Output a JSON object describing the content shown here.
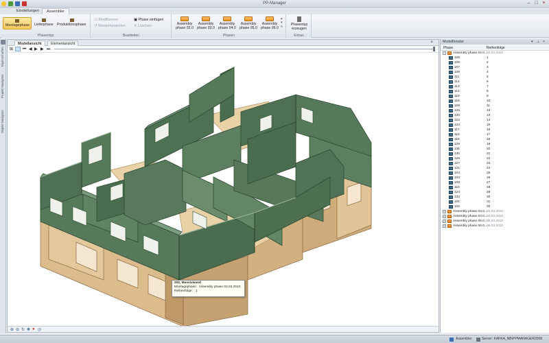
{
  "app": {
    "title": "PP-Manager"
  },
  "ribbon_tabs": [
    {
      "label": "Einstellungen"
    },
    {
      "label": "Assembler"
    }
  ],
  "ribbon": {
    "phasentyp": {
      "label": "Phasentyp",
      "buttons": [
        "Montagephase",
        "Lieferphase",
        "Produktionsphase"
      ]
    },
    "bearbeiten": {
      "label": "Bearbeiten",
      "buttons": [
        "Modifizieren",
        "Wiederherstellen",
        "Phase einfügen",
        "Löschen"
      ]
    },
    "phasen": {
      "label": "Phasen",
      "buttons": [
        {
          "line1": "Assembly",
          "line2": "phase 02.0"
        },
        {
          "line1": "Assembly",
          "line2": "phase 03.0"
        },
        {
          "line1": "Assembly",
          "line2": "phase 04.0"
        },
        {
          "line1": "Assembly",
          "line2": "phase 05.0"
        },
        {
          "line1": "Assembly",
          "line2": "phase 06.0"
        }
      ]
    },
    "extras": {
      "label": "Extras",
      "button_line1": "Phasentyp",
      "button_line2": "erzeugen"
    }
  },
  "left_strip": [
    "Eigenschaften",
    "Projekt Navigator",
    "Objekt Navigator"
  ],
  "doc_tabs": [
    {
      "label": "Modellansicht"
    },
    {
      "label": "Elementansicht"
    }
  ],
  "tooltip": {
    "title": "202, Massivwand",
    "line1_label": "Montagephase:",
    "line1_value": "Assembly phase 03.03.2010",
    "line2_label": "Reihenfolge:",
    "line2_value": "1"
  },
  "panel": {
    "title": "Modellfenster",
    "col_phase": "Phase",
    "col_order": "Reihenfolge",
    "phases": [
      {
        "name": "Assembly phase 02.0...",
        "date": "02.03.2010"
      },
      {
        "name": "Assembly phase 03.0...",
        "date": "03.03.2010"
      },
      {
        "name": "Assembly phase 04.0...",
        "date": "04.03.2010"
      },
      {
        "name": "Assembly phase 05.0...",
        "date": "05.03.2010"
      },
      {
        "name": "Assembly phase 06.0...",
        "date": "06.03.2010"
      }
    ],
    "elements": [
      {
        "name": "105",
        "order": "1"
      },
      {
        "name": "106",
        "order": "2"
      },
      {
        "name": "107",
        "order": "3"
      },
      {
        "name": "108",
        "order": "4"
      },
      {
        "name": "111",
        "order": "5"
      },
      {
        "name": "112",
        "order": "6"
      },
      {
        "name": "113",
        "order": "7"
      },
      {
        "name": "114",
        "order": "8"
      },
      {
        "name": "119",
        "order": "9"
      },
      {
        "name": "118",
        "order": "10"
      },
      {
        "name": "128",
        "order": "11"
      },
      {
        "name": "125",
        "order": "12"
      },
      {
        "name": "120",
        "order": "13"
      },
      {
        "name": "122",
        "order": "14"
      },
      {
        "name": "123",
        "order": "15"
      },
      {
        "name": "117",
        "order": "16"
      },
      {
        "name": "115",
        "order": "17"
      },
      {
        "name": "116",
        "order": "18"
      },
      {
        "name": "129",
        "order": "19"
      },
      {
        "name": "131",
        "order": "20"
      },
      {
        "name": "130",
        "order": "21"
      },
      {
        "name": "126",
        "order": "22"
      },
      {
        "name": "127",
        "order": "23"
      },
      {
        "name": "121",
        "order": "24"
      },
      {
        "name": "104",
        "order": "25"
      },
      {
        "name": "103",
        "order": "26"
      },
      {
        "name": "109",
        "order": "27"
      },
      {
        "name": "110",
        "order": "28"
      },
      {
        "name": "124",
        "order": "29"
      },
      {
        "name": "132",
        "order": "30"
      },
      {
        "name": "101",
        "order": "31"
      },
      {
        "name": "102",
        "order": "32"
      }
    ]
  },
  "status": {
    "mode": "Assembler",
    "server": "Server: KAFKA_NB\\PPMANAGER2008"
  },
  "colors": {
    "wall_green": "#56795a",
    "wall_wood": "#d9b98a",
    "accent_orange": "#f0a23a"
  }
}
